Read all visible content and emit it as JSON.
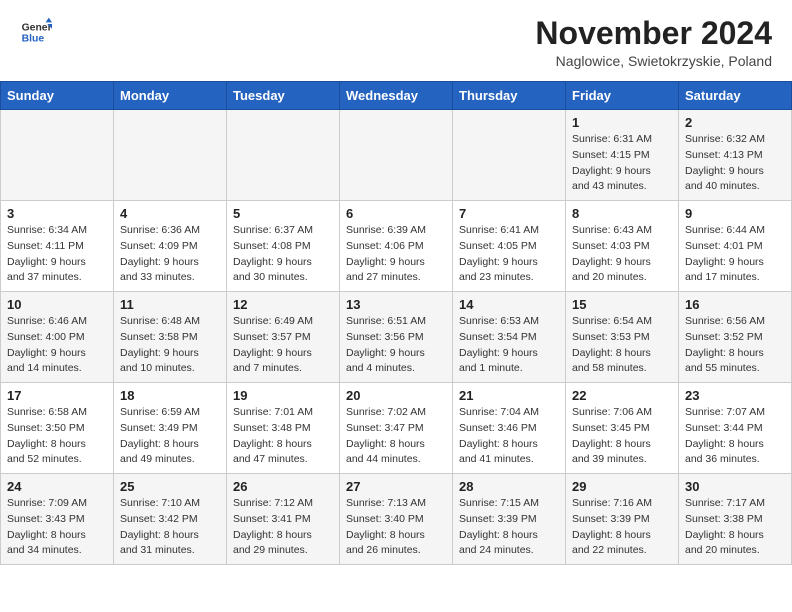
{
  "header": {
    "logo_line1": "General",
    "logo_line2": "Blue",
    "month_title": "November 2024",
    "location": "Naglowice, Swietokrzyskie, Poland"
  },
  "weekdays": [
    "Sunday",
    "Monday",
    "Tuesday",
    "Wednesday",
    "Thursday",
    "Friday",
    "Saturday"
  ],
  "weeks": [
    [
      {
        "day": "",
        "info": ""
      },
      {
        "day": "",
        "info": ""
      },
      {
        "day": "",
        "info": ""
      },
      {
        "day": "",
        "info": ""
      },
      {
        "day": "",
        "info": ""
      },
      {
        "day": "1",
        "info": "Sunrise: 6:31 AM\nSunset: 4:15 PM\nDaylight: 9 hours\nand 43 minutes."
      },
      {
        "day": "2",
        "info": "Sunrise: 6:32 AM\nSunset: 4:13 PM\nDaylight: 9 hours\nand 40 minutes."
      }
    ],
    [
      {
        "day": "3",
        "info": "Sunrise: 6:34 AM\nSunset: 4:11 PM\nDaylight: 9 hours\nand 37 minutes."
      },
      {
        "day": "4",
        "info": "Sunrise: 6:36 AM\nSunset: 4:09 PM\nDaylight: 9 hours\nand 33 minutes."
      },
      {
        "day": "5",
        "info": "Sunrise: 6:37 AM\nSunset: 4:08 PM\nDaylight: 9 hours\nand 30 minutes."
      },
      {
        "day": "6",
        "info": "Sunrise: 6:39 AM\nSunset: 4:06 PM\nDaylight: 9 hours\nand 27 minutes."
      },
      {
        "day": "7",
        "info": "Sunrise: 6:41 AM\nSunset: 4:05 PM\nDaylight: 9 hours\nand 23 minutes."
      },
      {
        "day": "8",
        "info": "Sunrise: 6:43 AM\nSunset: 4:03 PM\nDaylight: 9 hours\nand 20 minutes."
      },
      {
        "day": "9",
        "info": "Sunrise: 6:44 AM\nSunset: 4:01 PM\nDaylight: 9 hours\nand 17 minutes."
      }
    ],
    [
      {
        "day": "10",
        "info": "Sunrise: 6:46 AM\nSunset: 4:00 PM\nDaylight: 9 hours\nand 14 minutes."
      },
      {
        "day": "11",
        "info": "Sunrise: 6:48 AM\nSunset: 3:58 PM\nDaylight: 9 hours\nand 10 minutes."
      },
      {
        "day": "12",
        "info": "Sunrise: 6:49 AM\nSunset: 3:57 PM\nDaylight: 9 hours\nand 7 minutes."
      },
      {
        "day": "13",
        "info": "Sunrise: 6:51 AM\nSunset: 3:56 PM\nDaylight: 9 hours\nand 4 minutes."
      },
      {
        "day": "14",
        "info": "Sunrise: 6:53 AM\nSunset: 3:54 PM\nDaylight: 9 hours\nand 1 minute."
      },
      {
        "day": "15",
        "info": "Sunrise: 6:54 AM\nSunset: 3:53 PM\nDaylight: 8 hours\nand 58 minutes."
      },
      {
        "day": "16",
        "info": "Sunrise: 6:56 AM\nSunset: 3:52 PM\nDaylight: 8 hours\nand 55 minutes."
      }
    ],
    [
      {
        "day": "17",
        "info": "Sunrise: 6:58 AM\nSunset: 3:50 PM\nDaylight: 8 hours\nand 52 minutes."
      },
      {
        "day": "18",
        "info": "Sunrise: 6:59 AM\nSunset: 3:49 PM\nDaylight: 8 hours\nand 49 minutes."
      },
      {
        "day": "19",
        "info": "Sunrise: 7:01 AM\nSunset: 3:48 PM\nDaylight: 8 hours\nand 47 minutes."
      },
      {
        "day": "20",
        "info": "Sunrise: 7:02 AM\nSunset: 3:47 PM\nDaylight: 8 hours\nand 44 minutes."
      },
      {
        "day": "21",
        "info": "Sunrise: 7:04 AM\nSunset: 3:46 PM\nDaylight: 8 hours\nand 41 minutes."
      },
      {
        "day": "22",
        "info": "Sunrise: 7:06 AM\nSunset: 3:45 PM\nDaylight: 8 hours\nand 39 minutes."
      },
      {
        "day": "23",
        "info": "Sunrise: 7:07 AM\nSunset: 3:44 PM\nDaylight: 8 hours\nand 36 minutes."
      }
    ],
    [
      {
        "day": "24",
        "info": "Sunrise: 7:09 AM\nSunset: 3:43 PM\nDaylight: 8 hours\nand 34 minutes."
      },
      {
        "day": "25",
        "info": "Sunrise: 7:10 AM\nSunset: 3:42 PM\nDaylight: 8 hours\nand 31 minutes."
      },
      {
        "day": "26",
        "info": "Sunrise: 7:12 AM\nSunset: 3:41 PM\nDaylight: 8 hours\nand 29 minutes."
      },
      {
        "day": "27",
        "info": "Sunrise: 7:13 AM\nSunset: 3:40 PM\nDaylight: 8 hours\nand 26 minutes."
      },
      {
        "day": "28",
        "info": "Sunrise: 7:15 AM\nSunset: 3:39 PM\nDaylight: 8 hours\nand 24 minutes."
      },
      {
        "day": "29",
        "info": "Sunrise: 7:16 AM\nSunset: 3:39 PM\nDaylight: 8 hours\nand 22 minutes."
      },
      {
        "day": "30",
        "info": "Sunrise: 7:17 AM\nSunset: 3:38 PM\nDaylight: 8 hours\nand 20 minutes."
      }
    ]
  ]
}
